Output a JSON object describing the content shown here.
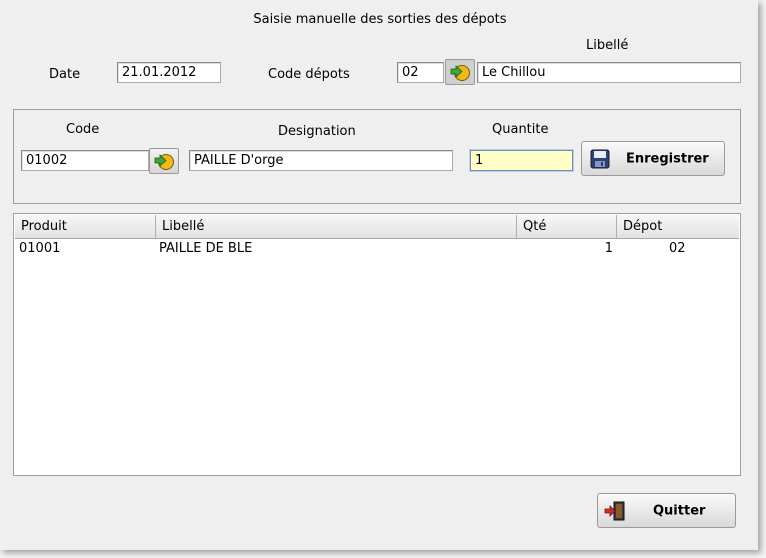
{
  "window": {
    "title": "Saisie manuelle des sorties des dépots"
  },
  "header": {
    "date_label": "Date",
    "date_value": "21.01.2012",
    "code_depots_label": "Code dépots",
    "code_depots_value": "02",
    "libelle_label": "Libellé",
    "libelle_value": "Le Chillou"
  },
  "entry": {
    "code_label": "Code",
    "code_value": "01002",
    "designation_label": "Designation",
    "designation_value": "PAILLE D'orge",
    "quantite_label": "Quantite",
    "quantite_value": "1",
    "save_label": "Enregistrer"
  },
  "table": {
    "columns": [
      "Produit",
      "Libellé",
      "Qté",
      "Dépot"
    ],
    "rows": [
      {
        "produit": "01001",
        "libelle": "PAILLE DE BLE",
        "qte": "1",
        "depot": "02"
      }
    ]
  },
  "footer": {
    "quit_label": "Quitter"
  },
  "icons": {
    "lookup": "arrow-circle-icon",
    "save": "floppy-disk-icon",
    "quit": "exit-door-icon"
  },
  "colors": {
    "active_field_bg": "#ffffc6",
    "window_bg": "#efefef"
  }
}
